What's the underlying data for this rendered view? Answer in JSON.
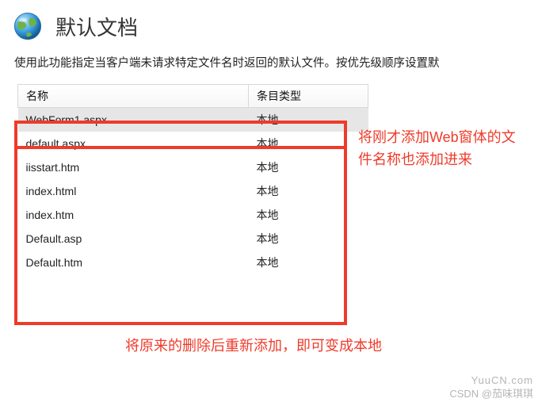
{
  "header": {
    "title": "默认文档",
    "icon": "globe-icon"
  },
  "description": "使用此功能指定当客户端未请求特定文件名时返回的默认文件。按优先级顺序设置默",
  "table": {
    "columns": {
      "name": "名称",
      "type": "条目类型"
    },
    "rows": [
      {
        "name": "WebForm1.aspx",
        "type": "本地",
        "selected": true
      },
      {
        "name": "default.aspx",
        "type": "本地",
        "selected": false
      },
      {
        "name": "iisstart.htm",
        "type": "本地",
        "selected": false
      },
      {
        "name": "index.html",
        "type": "本地",
        "selected": false
      },
      {
        "name": "index.htm",
        "type": "本地",
        "selected": false
      },
      {
        "name": "Default.asp",
        "type": "本地",
        "selected": false
      },
      {
        "name": "Default.htm",
        "type": "本地",
        "selected": false
      }
    ]
  },
  "annotations": {
    "right": "将刚才添加Web窗体的文件名称也添加进来",
    "bottom": "将原来的删除后重新添加，即可变成本地"
  },
  "watermark": {
    "line1": "YuuCN.com",
    "line2": "CSDN @茄味琪琪"
  },
  "colors": {
    "highlight": "#ee3b2a"
  }
}
